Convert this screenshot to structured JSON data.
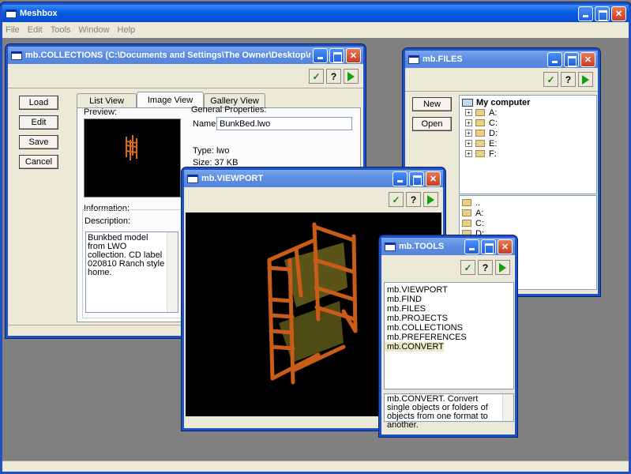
{
  "main": {
    "title": "Meshbox",
    "menu": [
      "File",
      "Edit",
      "Tools",
      "Window",
      "Help"
    ]
  },
  "collections": {
    "title": "mb.COLLECTIONS (C:\\Documents and Settings\\The Owner\\Desktop\\mes...",
    "buttons": [
      "Load",
      "Edit",
      "Save",
      "Cancel"
    ],
    "tabs": [
      "List View",
      "Image View",
      "Gallery View"
    ],
    "preview_label": "Preview:",
    "general_label": "General Properties:",
    "name_label": "Name:",
    "name_value": "BunkBed.lwo",
    "type_line": "Type:  lwo",
    "size_line": "Size:  37 KB",
    "information_label": "Information:",
    "description_label": "Description:",
    "description_text": "Bunkbed model from LWO collection. CD label 020810 Ranch style home."
  },
  "files": {
    "title": "mb.FILES",
    "buttons": [
      "New",
      "Open"
    ],
    "root": "My computer",
    "drives": [
      "A:",
      "C:",
      "D:",
      "E:",
      "F:"
    ],
    "folders": [
      "..",
      "A:",
      "C:",
      "D:"
    ]
  },
  "viewport": {
    "title": "mb.VIEWPORT"
  },
  "tools": {
    "title": "mb.TOOLS",
    "items": [
      "mb.VIEWPORT",
      "mb.FIND",
      "mb.FILES",
      "mb.PROJECTS",
      "mb.COLLECTIONS",
      "mb.PREFERENCES",
      "mb.CONVERT"
    ],
    "selected": "mb.CONVERT",
    "description": "mb.CONVERT. Convert single objects or folders of objects from one format to another."
  },
  "toolbar": {
    "help_label": "?"
  },
  "colors": {
    "titlebar": "#0a5fe0",
    "bed": "#d86a20",
    "viewport_bg": "#000000"
  },
  "icons": [
    "app-icon",
    "minimize-icon",
    "maximize-icon",
    "close-icon",
    "checkmark-icon",
    "help-icon",
    "run-icon",
    "folder-icon",
    "computer-icon",
    "expand-icon"
  ]
}
